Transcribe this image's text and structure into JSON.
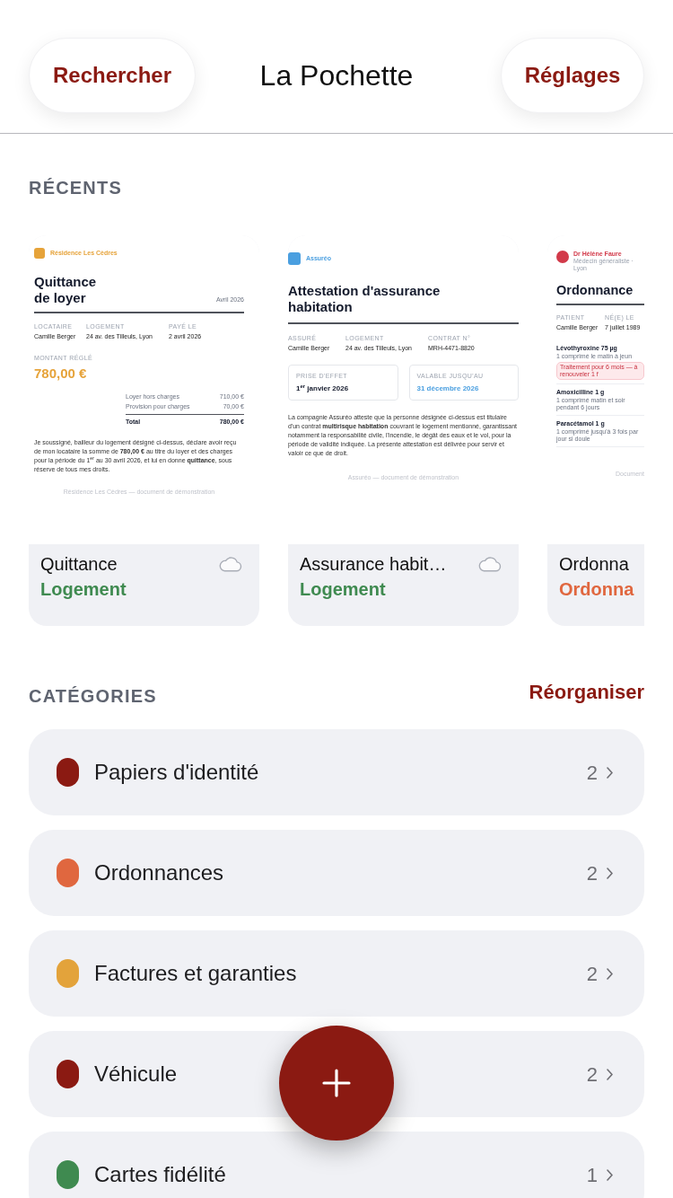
{
  "header": {
    "left_button": "Rechercher",
    "title": "La Pochette",
    "right_button": "Réglages"
  },
  "recents": {
    "heading": "RÉCENTS",
    "items": [
      {
        "title": "Quittance",
        "category": {
          "label": "Logement",
          "color": "#3f8a50"
        },
        "cloud": true,
        "document": {
          "kind": "receipt",
          "issuer": "Résidence Les Cèdres",
          "color": "#e6a33a",
          "title": "Quittance de loyer",
          "date": "Avril 2026",
          "fields": [
            {
              "label": "LOCATAIRE",
              "value": "Camille Berger"
            },
            {
              "label": "LOGEMENT",
              "value": "24 av. des Tilleuls, Lyon"
            },
            {
              "label": "PAYÉ LE",
              "value": "2 avril 2026"
            }
          ],
          "amount_label": "MONTANT RÉGLÉ",
          "amount": "780,00 €",
          "lines": [
            {
              "label": "Loyer hors charges",
              "value": "710,00 €"
            },
            {
              "label": "Provision pour charges",
              "value": "70,00 €"
            }
          ],
          "total": {
            "label": "Total",
            "value": "780,00 €"
          },
          "body": "Je soussigné, bailleur du logement désigné ci-dessus, déclare avoir reçu de mon locataire la somme de **780,00 €** au titre du loyer et des charges pour la période du 1$^{er}$ au 30 avril 2026, et lui en donne **quittance**, sous réserve de tous mes droits.",
          "footer": "Résidence Les Cèdres — document de démonstration"
        }
      },
      {
        "title": "Assurance habit…",
        "category": {
          "label": "Logement",
          "color": "#3f8a50"
        },
        "cloud": true,
        "document": {
          "kind": "certificate",
          "issuer": "Assuréo",
          "color": "#4a9fe0",
          "title": "Attestation d'assurance habitation",
          "fields": [
            {
              "label": "ASSURÉ",
              "value": "Camille Berger"
            },
            {
              "label": "LOGEMENT",
              "value": "24 av. des Tilleuls, Lyon"
            },
            {
              "label": "CONTRAT N°",
              "value": "MRH-4471-8820"
            }
          ],
          "boxes": [
            {
              "label": "PRISE D'EFFET",
              "value": "1$^{er}$ janvier 2026",
              "highlight": false
            },
            {
              "label": "VALABLE JUSQU'AU",
              "value": "31 décembre 2026",
              "highlight": true
            }
          ],
          "body": "La compagnie Assuréo atteste que la personne désignée ci-dessus est titulaire d'un contrat **multirisque habitation** couvrant le logement mentionné, garantissant notamment la responsabilité civile, l'incendie, le dégât des eaux et le vol, pour la période de validité indiquée. La présente attestation est délivrée pour servir et valoir ce que de droit.",
          "footer": "Assuréo — document de démonstration"
        }
      },
      {
        "title": "Ordonna",
        "category": {
          "label": "Ordonna",
          "color": "#e0673f"
        },
        "document": {
          "kind": "prescription",
          "issuer": "Dr Hélène Faure",
          "subtitle": "Médecin généraliste · Lyon",
          "color": "#d23a4a",
          "title": "Ordonnance",
          "fields": [
            {
              "label": "PATIENT",
              "value": "Camille Berger"
            },
            {
              "label": "NÉ(E) LE",
              "value": "7 juillet 1989"
            }
          ],
          "medications": [
            {
              "name": "Lévothyroxine 75 µg",
              "dosage": "1 comprimé le matin à jeun",
              "note": "Traitement pour 6 mois — à renouveler 1 f"
            },
            {
              "name": "Amoxicilline 1 g",
              "dosage": "1 comprimé matin et soir pendant 6 jours"
            },
            {
              "name": "Paracétamol 1 g",
              "dosage": "1 comprimé jusqu'à 3 fois par jour si doule"
            }
          ],
          "footer": "Document"
        }
      }
    ]
  },
  "categories": {
    "heading": "CATÉGORIES",
    "action": "Réorganiser",
    "items": [
      {
        "label": "Papiers d'identité",
        "count": "2",
        "color": "#8b1a12"
      },
      {
        "label": "Ordonnances",
        "count": "2",
        "color": "#e0673f"
      },
      {
        "label": "Factures et garanties",
        "count": "2",
        "color": "#e3a33b"
      },
      {
        "label": "Véhicule",
        "count": "2",
        "color": "#8b1a12"
      },
      {
        "label": "Cartes fidélité",
        "count": "1",
        "color": "#3f8a50"
      }
    ]
  }
}
